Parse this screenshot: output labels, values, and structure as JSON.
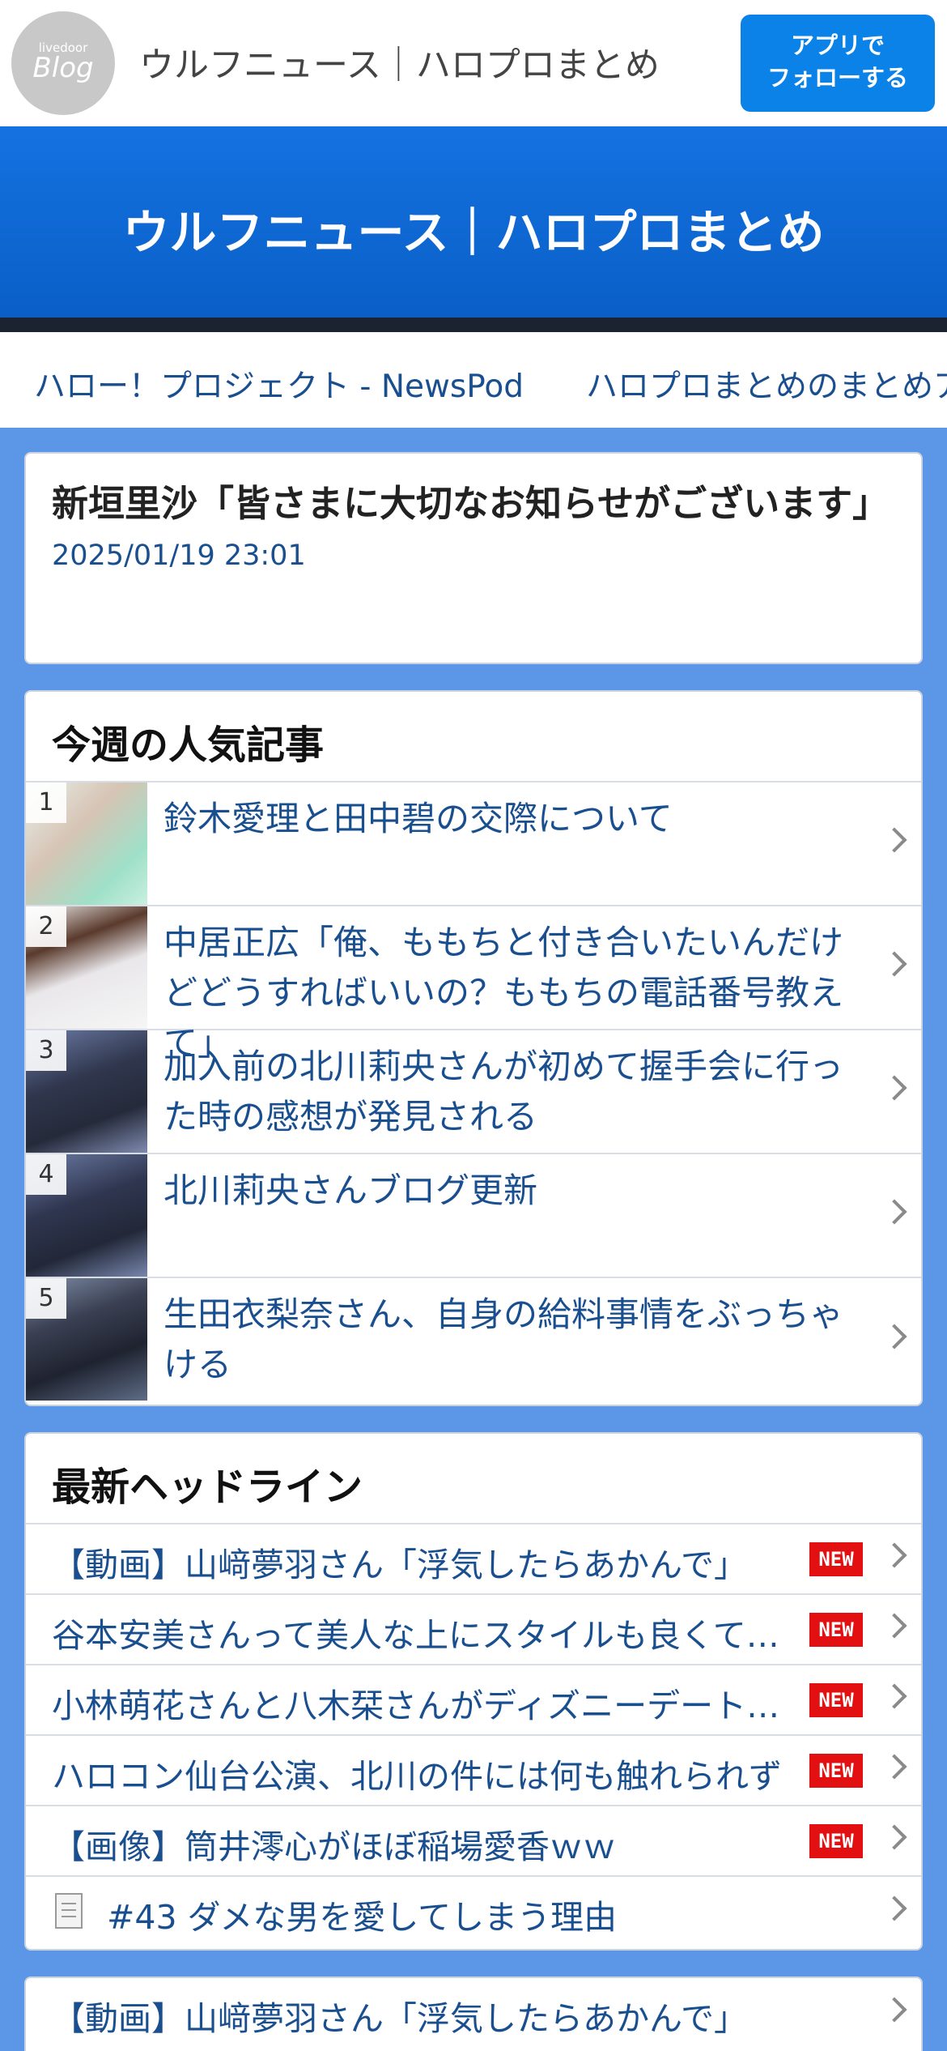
{
  "header": {
    "logo": {
      "small": "livedoor",
      "big": "Blog"
    },
    "site_title": "ウルフニュース｜ハロプロまとめ",
    "follow_button": {
      "line1": "アプリで",
      "line2": "フォローする"
    }
  },
  "banner": {
    "title": "ウルフニュース｜ハロプロまとめ"
  },
  "link_strip": [
    "ハロー！プロジェクト - NewsPod",
    "ハロプロまとめのまとめア"
  ],
  "article": {
    "title": "新垣里沙「皆さまに大切なお知らせがございます」",
    "date": "2025/01/19 23:01"
  },
  "popular": {
    "title": "今週の人気記事",
    "items": [
      {
        "rank": "1",
        "text": "鈴木愛理と田中碧の交際について"
      },
      {
        "rank": "2",
        "text": "中居正広「俺、ももちと付き合いたいんだけどどうすればいいの？ももちの電話番号教えて」"
      },
      {
        "rank": "3",
        "text": "加入前の北川莉央さんが初めて握手会に行った時の感想が発見される"
      },
      {
        "rank": "4",
        "text": "北川莉央さんブログ更新"
      },
      {
        "rank": "5",
        "text": "生田衣梨奈さん、自身の給料事情をぶっちゃける"
      }
    ]
  },
  "headlines": {
    "title": "最新ヘッドライン",
    "new_label": "NEW",
    "items": [
      {
        "text": "【動画】山﨑夢羽さん「浮気したらあかんで」",
        "new": true
      },
      {
        "text": "谷本安美さんって美人な上にスタイルも良くて…",
        "new": true
      },
      {
        "text": "小林萌花さんと八木栞さんがディズニーデート…",
        "new": true
      },
      {
        "text": "ハロコン仙台公演、北川の件には何も触れられず",
        "new": true
      },
      {
        "text": "【画像】筒井澪心がほぼ稲場愛香ｗｗ",
        "new": true
      },
      {
        "text": "#43 ダメな男を愛してしまう理由",
        "new": false,
        "icon": "document-icon"
      }
    ]
  },
  "bottom": {
    "items": [
      {
        "text": "【動画】山﨑夢羽さん「浮気したらあかんで」"
      }
    ]
  }
}
